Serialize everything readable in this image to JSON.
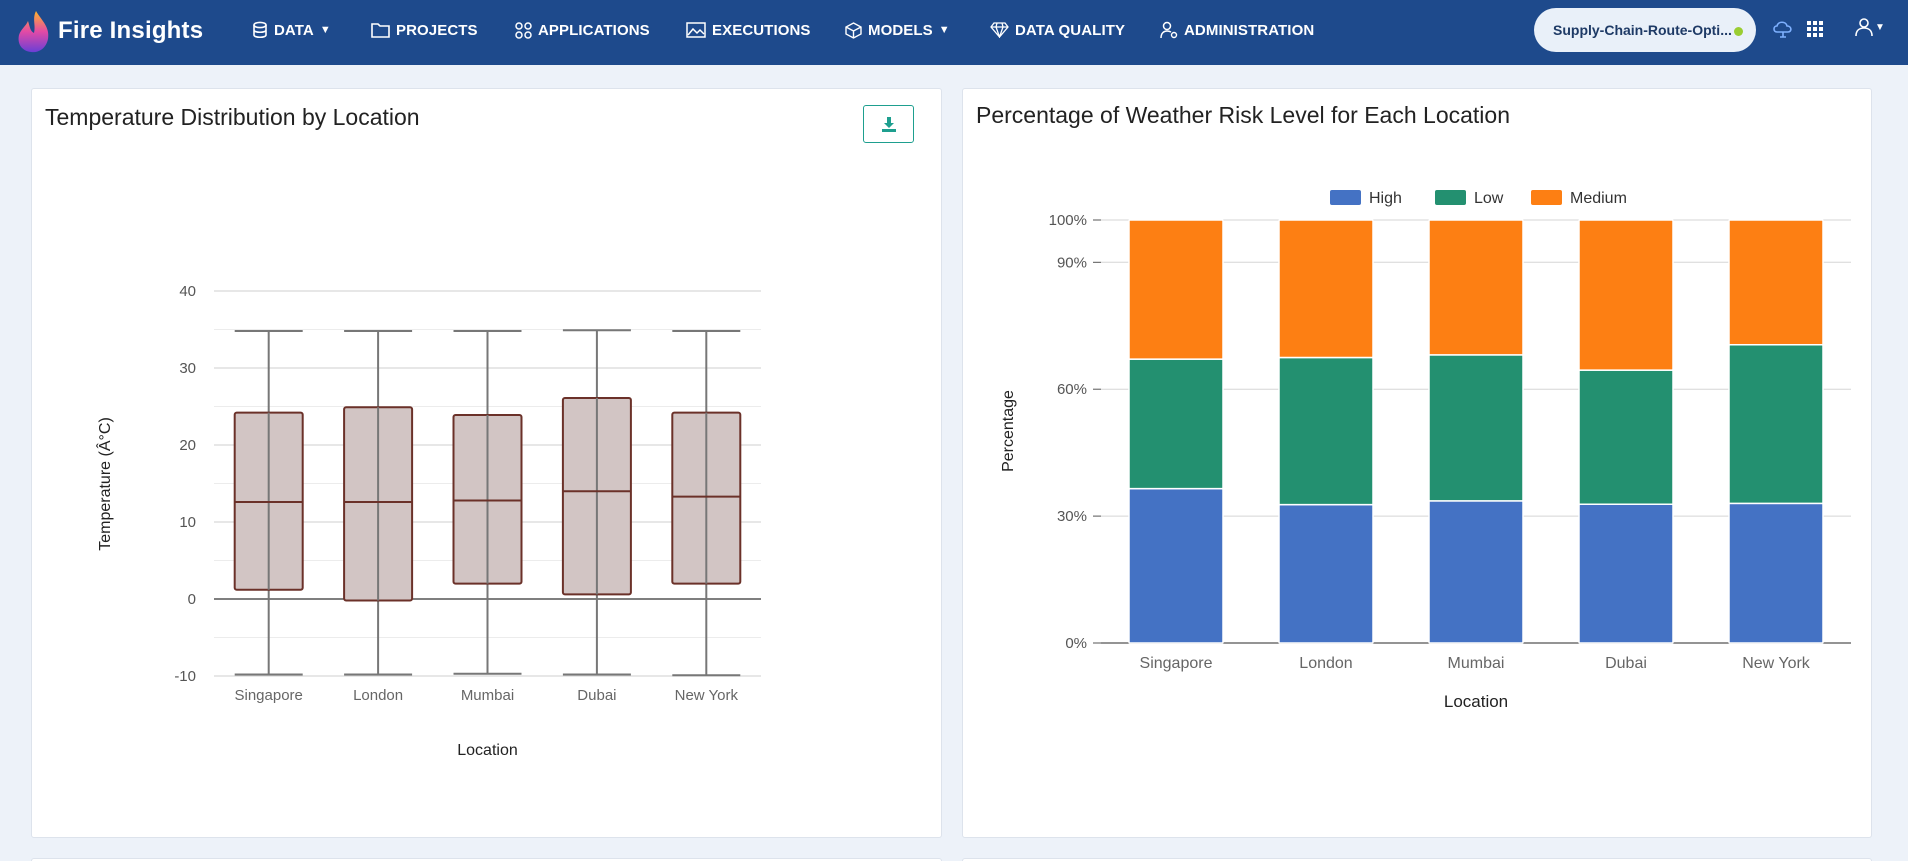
{
  "app": {
    "name": "Fire Insights"
  },
  "nav": {
    "items": [
      {
        "label": "DATA",
        "icon": "database-icon",
        "dropdown": true
      },
      {
        "label": "PROJECTS",
        "icon": "folder-icon",
        "dropdown": false
      },
      {
        "label": "APPLICATIONS",
        "icon": "apps-icon",
        "dropdown": false
      },
      {
        "label": "EXECUTIONS",
        "icon": "chart-image-icon",
        "dropdown": false
      },
      {
        "label": "MODELS",
        "icon": "cube-icon",
        "dropdown": true
      },
      {
        "label": "DATA QUALITY",
        "icon": "diamond-icon",
        "dropdown": false
      },
      {
        "label": "ADMINISTRATION",
        "icon": "user-gear-icon",
        "dropdown": false
      }
    ],
    "project": "Supply-Chain-Route-Opti...",
    "project_status_color": "#9acd32",
    "icons": [
      "cloud-icon",
      "grid-icon",
      "user-icon"
    ]
  },
  "colors": {
    "navbar": "#1e4a8c",
    "accent": "#1e9f8f"
  },
  "chart_data": [
    {
      "type": "box",
      "title": "Temperature Distribution by Location",
      "xlabel": "Location",
      "ylabel": "Temperature (Â°C)",
      "ylim": [
        -10,
        40
      ],
      "yticks": [
        -10,
        0,
        10,
        20,
        30,
        40
      ],
      "categories": [
        "Singapore",
        "London",
        "Mumbai",
        "Dubai",
        "New York"
      ],
      "boxes": [
        {
          "min": -9.8,
          "q1": 1.2,
          "median": 12.6,
          "q3": 24.2,
          "max": 34.8
        },
        {
          "min": -9.8,
          "q1": -0.2,
          "median": 12.6,
          "q3": 24.9,
          "max": 34.8
        },
        {
          "min": -9.7,
          "q1": 2.0,
          "median": 12.8,
          "q3": 23.9,
          "max": 34.8
        },
        {
          "min": -9.8,
          "q1": 0.6,
          "median": 14.0,
          "q3": 26.1,
          "max": 34.9
        },
        {
          "min": -9.9,
          "q1": 2.0,
          "median": 13.3,
          "q3": 24.2,
          "max": 34.8
        }
      ],
      "box_fill": "#d2c5c4",
      "box_stroke": "#6b3129",
      "whisker_color": "#777777",
      "grid": true,
      "download_icon": "download-icon"
    },
    {
      "type": "stacked-bar",
      "title": "Percentage of Weather Risk Level for Each Location",
      "xlabel": "Location",
      "ylabel": "Percentage",
      "ylim": [
        0,
        100
      ],
      "ytick_labels": [
        "0%",
        "30%",
        "60%",
        "90%",
        "100%"
      ],
      "ytick_values": [
        0,
        30,
        60,
        90,
        100
      ],
      "legend_position": "top",
      "categories": [
        "Singapore",
        "London",
        "Mumbai",
        "Dubai",
        "New York"
      ],
      "series": [
        {
          "name": "High",
          "color": "#4472c4",
          "values": [
            36.5,
            32.7,
            33.6,
            32.8,
            33.0
          ]
        },
        {
          "name": "Low",
          "color": "#239070",
          "values": [
            30.6,
            34.8,
            34.5,
            31.7,
            37.5
          ]
        },
        {
          "name": "Medium",
          "color": "#fd7f13",
          "values": [
            32.9,
            32.5,
            31.9,
            35.5,
            29.5
          ]
        }
      ]
    }
  ]
}
